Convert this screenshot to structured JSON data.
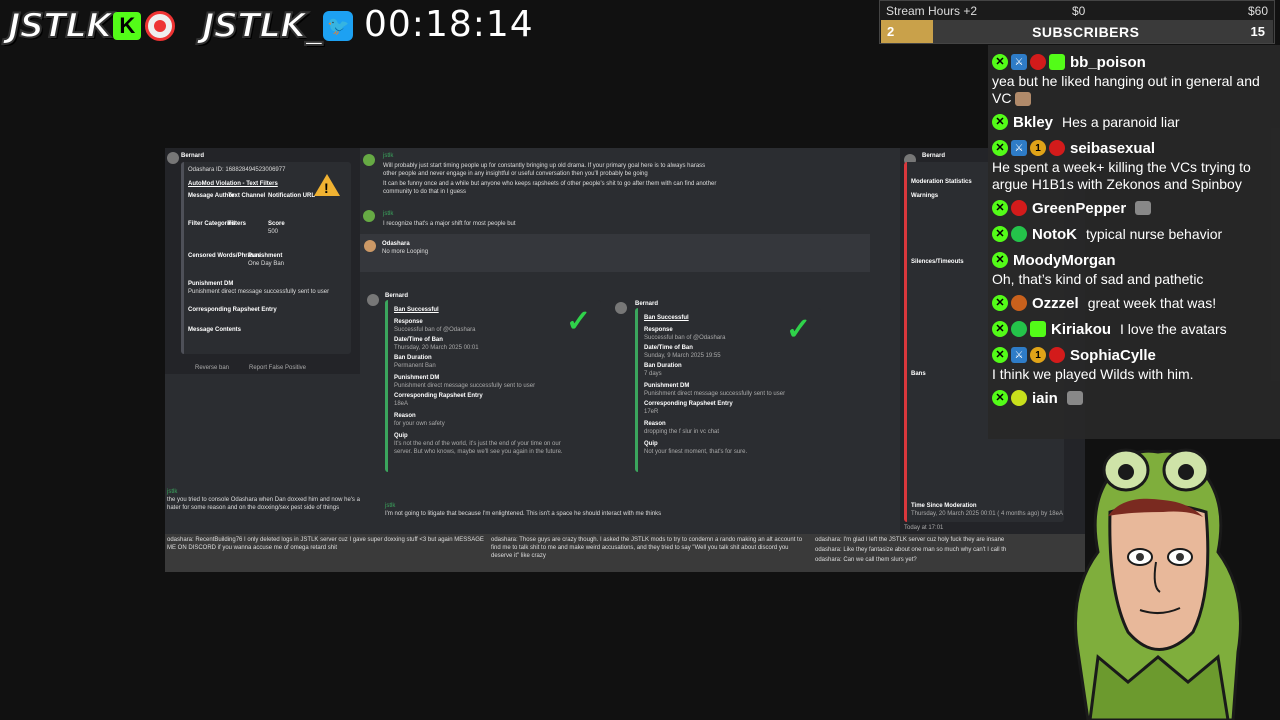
{
  "branding": {
    "kick_name": "JSTLK",
    "kick_icon": "kick-icon",
    "kick_letter": "K",
    "twitter_name": "JSTLK_",
    "twitter_icon": "twitter-icon"
  },
  "timer": "00:18:14",
  "goal": {
    "label": "Stream Hours +2",
    "start": "$0",
    "end": "$60",
    "count": "2",
    "title": "SUBSCRIBERS",
    "target": "15",
    "progress": 0.133,
    "bar_color": "#c9a14a"
  },
  "chat": {
    "messages": [
      {
        "user": "bb_poison",
        "text": "yea but he liked hanging out in general and VC"
      },
      {
        "user": "Bkley",
        "text": "Hes a paranoid liar"
      },
      {
        "user": "seibasexual",
        "text": "He spent a week+ killing the VCs trying to argue H1B1s with Zekonos and Spinboy"
      },
      {
        "user": "GreenPepper",
        "text": ""
      },
      {
        "user": "NotoK",
        "text": "typical nurse behavior"
      },
      {
        "user": "MoodyMorgan",
        "text": "Oh, that’s kind of sad and pathetic"
      },
      {
        "user": "Ozzzel",
        "text": "great week that was!"
      },
      {
        "user": "Kiriakou",
        "text": "I love the avatars"
      },
      {
        "user": "SophiaCylle",
        "text": "I think we played Wilds with him."
      },
      {
        "user": "iain",
        "text": ""
      }
    ]
  },
  "screen": {
    "left_embed": {
      "author": "Bernard",
      "id_line": "Odashara   ID: 168828494523006977",
      "title": "AutoMod Violation - Text Filters",
      "field1": "Message Author",
      "field2": "Text Channel",
      "field3": "Notification URL",
      "field4": "Filter Categories",
      "field5": "Filters",
      "field6": "Score",
      "score": "500",
      "field7": "Censored Words/Phrases",
      "field8": "Punishment",
      "punishment": "One Day Ban",
      "field9": "Punishment DM",
      "field9_val": "Punishment direct message successfully sent to user",
      "field10": "Corresponding Rapsheet Entry",
      "field11": "Message Contents",
      "buttons": [
        "Reverse ban",
        "Report False Positive"
      ]
    },
    "center_messages": [
      "Will probably just start timing people up for constantly bringing up old drama. If your primary goal here is to always harass",
      "other people and never engage in any insightful or useful conversation then you'll probably be going",
      "It can be funny once and a while but anyone who keeps rapsheets of other people's shit to go after them with can find another",
      "community to do that in I guess",
      "I recognize that's a major shift for most people but",
      "No more Looping"
    ],
    "ban1": {
      "title": "Ban Successful",
      "response": "Successful ban of @Odashara",
      "date_label": "Date/Time of Ban",
      "date": "Thursday, 20 March 2025 00:01",
      "duration_label": "Ban Duration",
      "duration": "Permanent Ban",
      "dm_label": "Punishment DM",
      "dm": "Punishment direct message successfully sent to user",
      "rap_label": "Corresponding Rapsheet Entry",
      "rap": "18eA",
      "reason_label": "Reason",
      "reason": "for your own safety",
      "quip_label": "Quip",
      "quip": "It's not the end of the world, it's just the end of your time on our server. But who knows, maybe we'll see you again in the future."
    },
    "ban2": {
      "title": "Ban Successful",
      "response": "Successful ban of @Odashara",
      "date_label": "Date/Time of Ban",
      "date": "Sunday, 9 March 2025 19:55",
      "duration_label": "Ban Duration",
      "duration": "7 days",
      "dm_label": "Punishment DM",
      "dm": "Punishment direct message successfully sent to user",
      "rap_label": "Corresponding Rapsheet Entry",
      "rap": "17eR",
      "reason_label": "Reason",
      "reason": "dropping the f slur in vc chat",
      "quip_label": "Quip",
      "quip": "Not your finest moment, that's for sure."
    },
    "bottom_messages": [
      "the you tried to console Odashara when Dan doxxed him and now he's a hater for some reason and on the doxxing/sex pest side of things",
      "I'm not going to litigate that because I'm enlightened. This isn't a space he should interact with me thinks"
    ],
    "log_lines": [
      "odashara: RecentBuilding76 I only deleted logs in JSTLK server cuz I gave super doxxing stuff <3 but again MESSAGE ME ON DISCORD if you wanna accuse me of omega retard shit",
      "odashara: Those guys are crazy though. I asked the JSTLK mods to try to condemn a rando making an alt account to find me to talk shit to me and make weird accusations, and they tried to say \"Well you talk shit about discord you deserve it\" like crazy",
      "odashara: I'm glad I left the JSTLK server cuz holy fuck they are insane",
      "odashara: Like they fantasize about one man so much why can't I call th",
      "odashara: Can we call them slurs yet?"
    ],
    "right_panel": {
      "title": "Moderation Statistics",
      "sections": [
        "Warnings",
        "Silences/Timeouts",
        "Bans",
        "Time Since Moderation"
      ],
      "time_since": "Thursday, 20 March 2025 00:01 ( 4 months ago) by 18eA",
      "today": "Today at 17:01"
    }
  }
}
